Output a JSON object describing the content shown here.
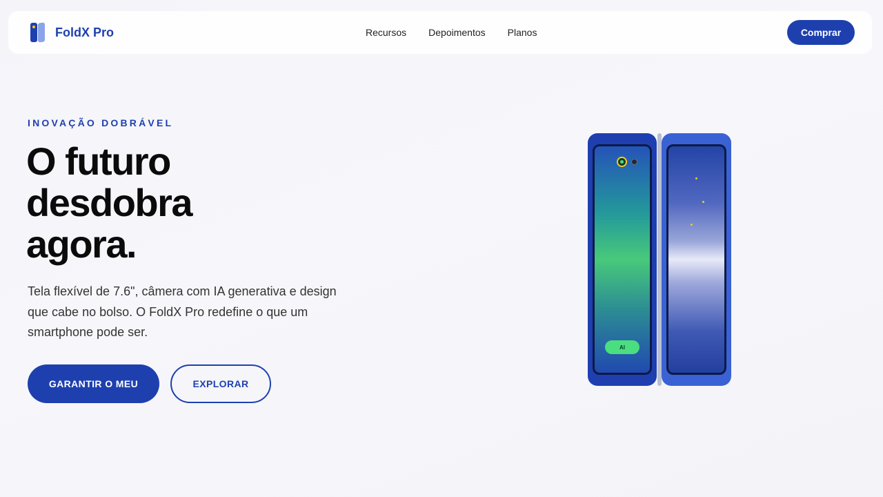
{
  "header": {
    "brand": "FoldX Pro",
    "nav": [
      "Recursos",
      "Depoimentos",
      "Planos"
    ],
    "buy_label": "Comprar"
  },
  "hero": {
    "eyebrow": "INOVAÇÃO DOBRÁVEL",
    "headline_lines": [
      "O futuro",
      "desdobra",
      "agora."
    ],
    "subtext_lines": [
      "Tela flexível de 7.6\", câmera com IA generativa e design",
      "que cabe no bolso. O FoldX Pro redefine o que um",
      "smartphone pode ser."
    ],
    "primary_cta": "GARANTIR O MEU",
    "secondary_cta": "EXPLORAR"
  },
  "device": {
    "ai_badge": "AI",
    "icons": [
      "camera-lens-icon",
      "camera-sensor-icon",
      "star-icon"
    ]
  },
  "colors": {
    "brand": "#1e40af",
    "accent": "#facc15",
    "ai_green": "#4ade80",
    "background": "#f5f5fa"
  }
}
